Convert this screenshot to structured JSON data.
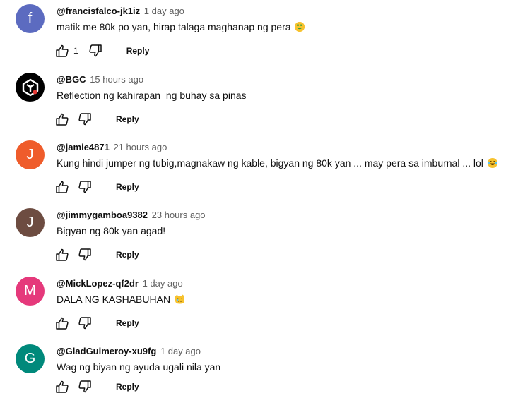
{
  "reply_label": "Reply",
  "icons": {
    "like": "thumbs-up-icon",
    "dislike": "thumbs-down-icon"
  },
  "comments": [
    {
      "handle": "@francisfalco-jk1iz",
      "time": "1 day ago",
      "text": "matik me 80k po yan, hirap talaga maghanap ng pera",
      "emoji": "money-mouth-face",
      "avatar": {
        "letter": "f",
        "color": "#5c6bc0"
      },
      "likes": "1"
    },
    {
      "handle": "@BGC",
      "time": "15 hours ago",
      "text": "Reflection ng kahirapan  ng buhay sa pinas",
      "avatar": {
        "letter": "",
        "color": "#000000",
        "icon": "bgc-logo-icon"
      },
      "likes": ""
    },
    {
      "handle": "@jamie4871",
      "time": "21 hours ago",
      "text": "Kung hindi jumper ng tubig,magnakaw ng kable, bigyan ng 80k yan ... may pera sa imburnal ... lol",
      "emoji": "laughing-tears-face",
      "avatar": {
        "letter": "J",
        "color": "#ef5c2b"
      },
      "likes": ""
    },
    {
      "handle": "@jimmygamboa9382",
      "time": "23 hours ago",
      "text": "Bigyan ng 80k yan agad!",
      "avatar": {
        "letter": "J",
        "color": "#6d4c41"
      },
      "likes": ""
    },
    {
      "handle": "@MickLopez-qf2dr",
      "time": "1 day ago",
      "text": "DALA NG KASHABUHAN",
      "emoji": "crying-cat-face",
      "avatar": {
        "letter": "M",
        "color": "#e5397b"
      },
      "likes": ""
    },
    {
      "handle": "@GladGuimeroy-xu9fg",
      "time": "1 day ago",
      "text": "Wag ng biyan ng ayuda ugali nila yan",
      "avatar": {
        "letter": "G",
        "color": "#00897b"
      },
      "likes": ""
    }
  ]
}
